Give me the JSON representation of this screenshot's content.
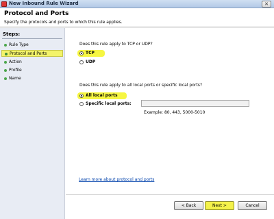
{
  "window": {
    "title": "New Inbound Rule Wizard",
    "close_glyph": "✕"
  },
  "header": {
    "title": "Protocol and Ports",
    "subtitle": "Specify the protocols and ports to which this rule applies."
  },
  "sidebar": {
    "heading": "Steps:",
    "items": [
      {
        "label": "Rule Type"
      },
      {
        "label": "Protocol and Ports"
      },
      {
        "label": "Action"
      },
      {
        "label": "Profile"
      },
      {
        "label": "Name"
      }
    ]
  },
  "main": {
    "protocol_question": "Does this rule apply to TCP or UDP?",
    "protocol_options": {
      "tcp": "TCP",
      "udp": "UDP"
    },
    "ports_question": "Does this rule apply to all local ports or specific local ports?",
    "port_options": {
      "all": "All local ports",
      "specific": "Specific local ports:"
    },
    "port_value": "",
    "example_text": "Example: 80, 443, 5000-5010",
    "learn_link": "Learn more about protocol and ports"
  },
  "buttons": {
    "back": "< Back",
    "next": "Next >",
    "cancel": "Cancel"
  },
  "colors": {
    "highlight": "#f6f642",
    "sidebar_bg": "#e8ecf4",
    "link": "#0645ad"
  }
}
